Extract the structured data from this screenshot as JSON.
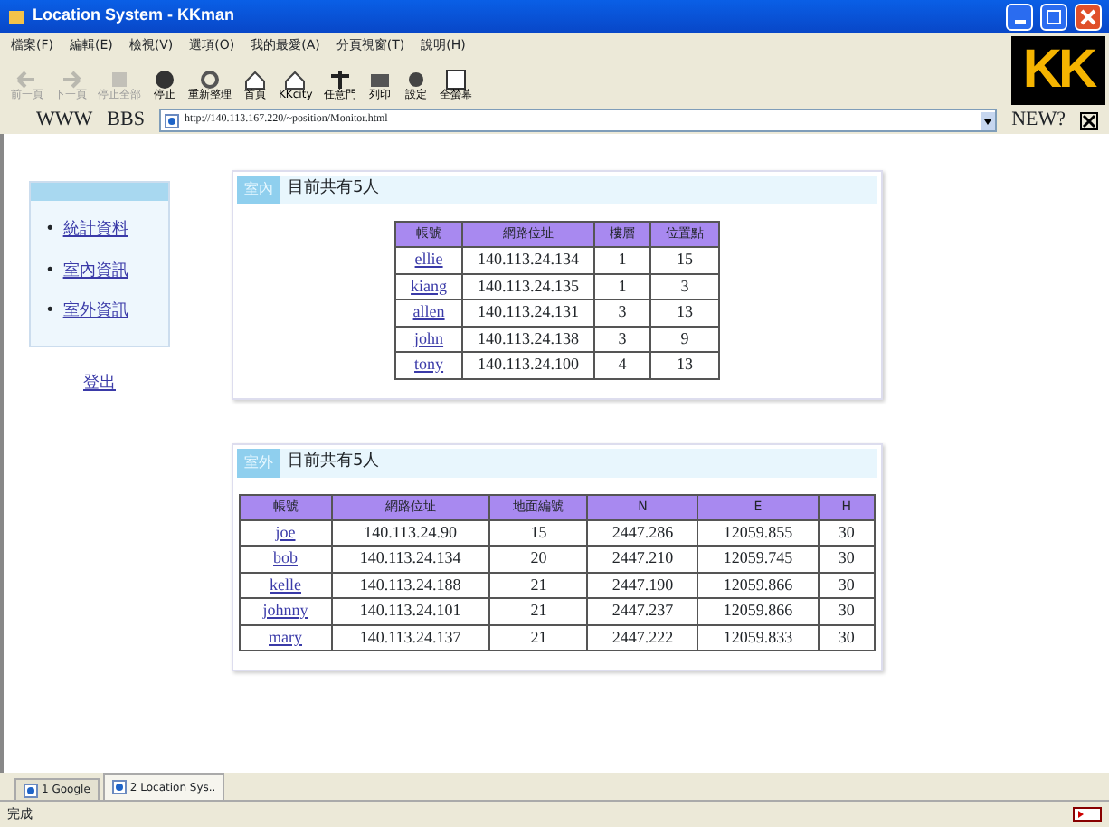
{
  "window": {
    "title": "Location System - KKman"
  },
  "menu": [
    "檔案(F)",
    "編輯(E)",
    "檢視(V)",
    "選項(O)",
    "我的最愛(A)",
    "分頁視窗(T)",
    "說明(H)"
  ],
  "toolbar": [
    {
      "label": "前一頁",
      "disabled": true
    },
    {
      "label": "下一頁",
      "disabled": true
    },
    {
      "label": "停止全部",
      "disabled": true
    },
    {
      "label": "停止",
      "disabled": false
    },
    {
      "label": "重新整理",
      "disabled": false
    },
    {
      "label": "首頁",
      "disabled": false
    },
    {
      "label": "KKcity",
      "disabled": false
    },
    {
      "label": "任意門",
      "disabled": false
    },
    {
      "label": "列印",
      "disabled": false
    },
    {
      "label": "設定",
      "disabled": false
    },
    {
      "label": "全螢幕",
      "disabled": false
    }
  ],
  "logo": "KK",
  "address_bar": {
    "links": [
      "WWW",
      "BBS"
    ],
    "url": "http://140.113.167.220/~position/Monitor.html",
    "new_label": "NEW?"
  },
  "sidebar": {
    "items": [
      {
        "bullet": "•",
        "label": "統計資料"
      },
      {
        "bullet": "•",
        "label": "室內資訊"
      },
      {
        "bullet": "•",
        "label": "室外資訊"
      }
    ],
    "logout": "登出"
  },
  "panels": [
    {
      "tag": "室內",
      "summary": "目前共有5人",
      "columns": [
        "帳號",
        "網路位址",
        "樓層",
        "位置點"
      ],
      "rows": [
        [
          "ellie",
          "140.113.24.134",
          "1",
          "15"
        ],
        [
          "kiang",
          "140.113.24.135",
          "1",
          "3"
        ],
        [
          "allen",
          "140.113.24.131",
          "3",
          "13"
        ],
        [
          "john",
          "140.113.24.138",
          "3",
          "9"
        ],
        [
          "tony",
          "140.113.24.100",
          "4",
          "13"
        ]
      ]
    },
    {
      "tag": "室外",
      "summary": "目前共有5人",
      "columns": [
        "帳號",
        "網路位址",
        "地面編號",
        "N",
        "E",
        "H"
      ],
      "rows": [
        [
          "joe",
          "140.113.24.90",
          "15",
          "2447.286",
          "12059.855",
          "30"
        ],
        [
          "bob",
          "140.113.24.134",
          "20",
          "2447.210",
          "12059.745",
          "30"
        ],
        [
          "kelle",
          "140.113.24.188",
          "21",
          "2447.190",
          "12059.866",
          "30"
        ],
        [
          "johnny",
          "140.113.24.101",
          "21",
          "2447.237",
          "12059.866",
          "30"
        ],
        [
          "mary",
          "140.113.24.137",
          "21",
          "2447.222",
          "12059.833",
          "30"
        ]
      ]
    }
  ],
  "tabs": [
    {
      "label": "1 Google",
      "selected": false
    },
    {
      "label": "2 Location Sys..",
      "selected": true
    }
  ],
  "status_bar": {
    "text": "完成"
  }
}
